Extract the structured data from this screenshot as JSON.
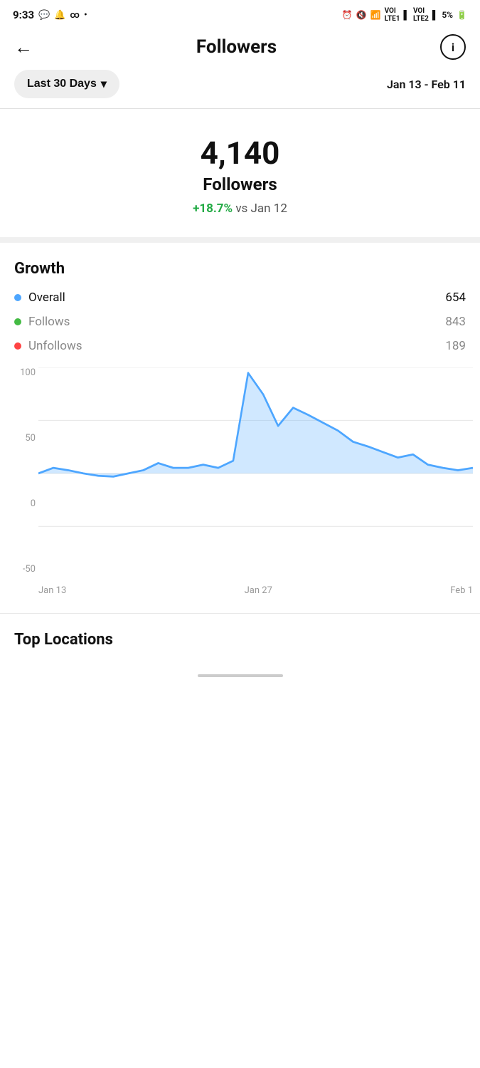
{
  "statusBar": {
    "time": "9:33",
    "icons_left": [
      "whatsapp-icon",
      "notification-icon",
      "infinity-icon",
      "dot-icon"
    ],
    "icons_right": [
      "alarm-icon",
      "mute-icon",
      "wifi-icon",
      "lte1-icon",
      "signal1-icon",
      "lte2-icon",
      "signal2-icon"
    ],
    "battery": "5%"
  },
  "header": {
    "back_label": "←",
    "title": "Followers",
    "info_label": "i"
  },
  "filter": {
    "date_filter_label": "Last 30 Days",
    "chevron": "▾",
    "date_range": "Jan 13 - Feb 11"
  },
  "stats": {
    "number": "4,140",
    "label": "Followers",
    "change_positive": "+18.7%",
    "change_suffix": " vs Jan 12"
  },
  "growth": {
    "title": "Growth",
    "items": [
      {
        "dot_class": "dot-blue",
        "label": "Overall",
        "muted": false,
        "value": "654",
        "value_muted": false
      },
      {
        "dot_class": "dot-green",
        "label": "Follows",
        "muted": true,
        "value": "843",
        "value_muted": true
      },
      {
        "dot_class": "dot-red",
        "label": "Unfollows",
        "muted": true,
        "value": "189",
        "value_muted": true
      }
    ]
  },
  "chart": {
    "y_labels": [
      "100",
      "50",
      "0",
      "-50"
    ],
    "x_labels": [
      "Jan 13",
      "Jan 27",
      "Feb 1"
    ],
    "description": "Area chart showing follower growth"
  },
  "topLocations": {
    "title": "Top Locations"
  }
}
